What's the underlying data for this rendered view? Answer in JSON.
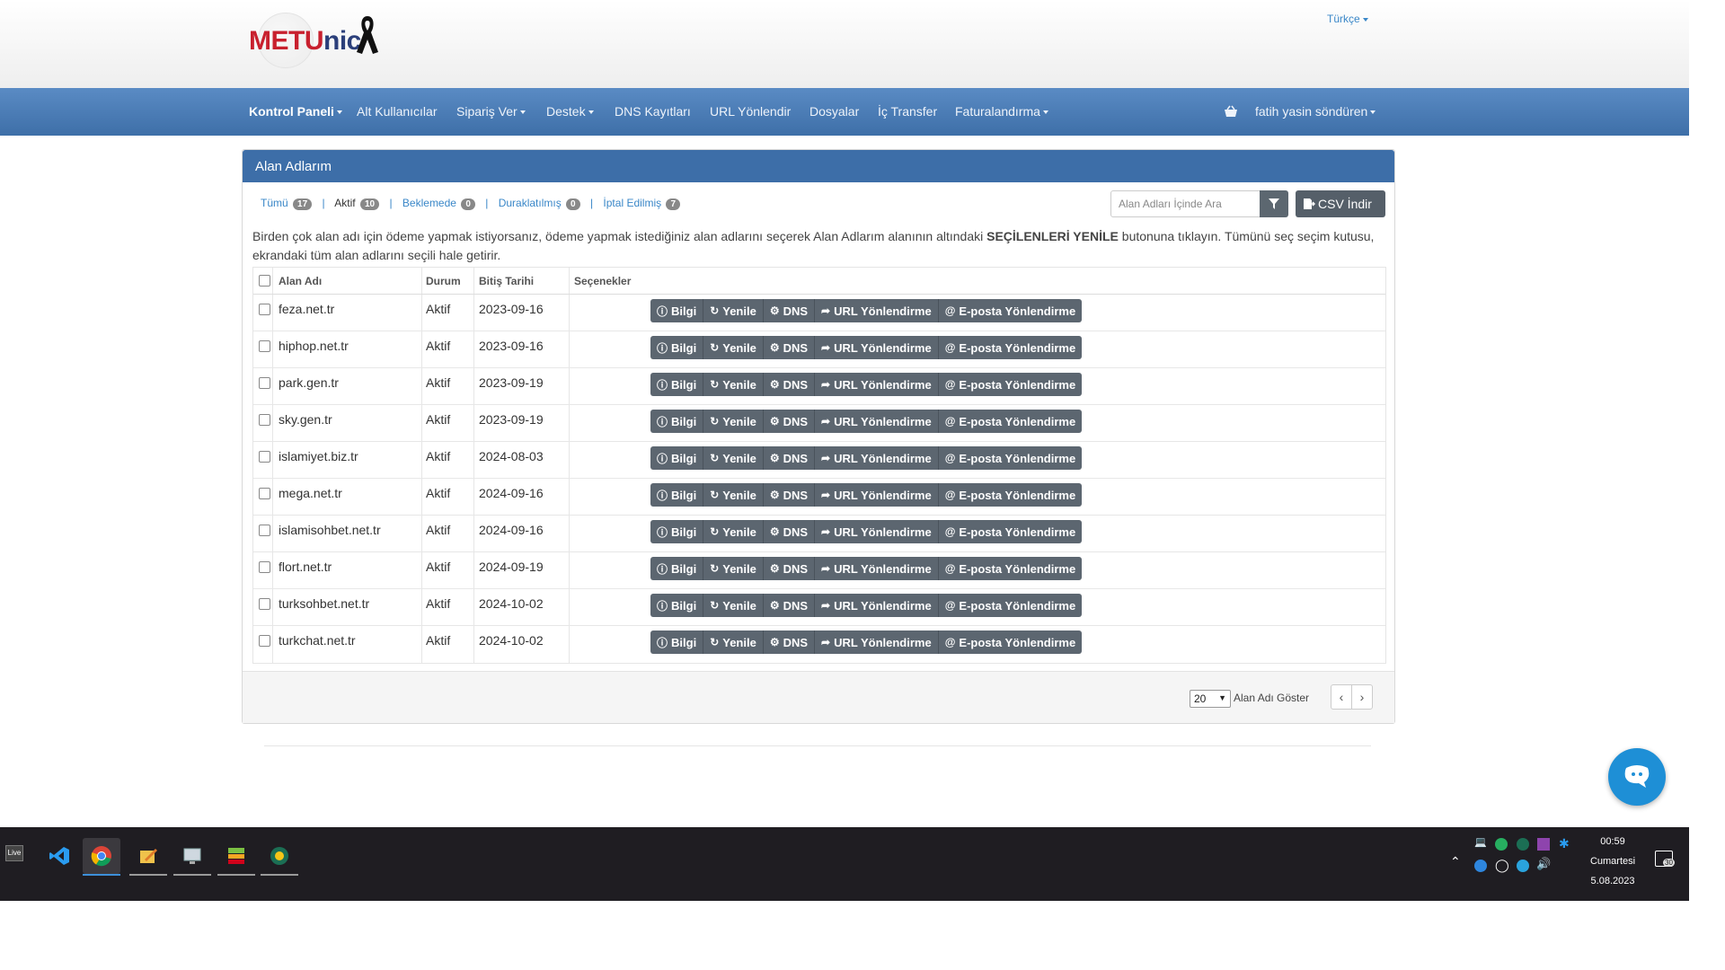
{
  "header": {
    "logo_text_metu": "METU",
    "logo_text_nic": "nic",
    "language": "Türkçe"
  },
  "nav": {
    "items": [
      "Kontrol Paneli",
      "Alt Kullanıcılar",
      "Sipariş Ver",
      "Destek",
      "DNS Kayıtları",
      "URL Yönlendir",
      "Dosyalar",
      "İç Transfer",
      "Faturalandırma"
    ],
    "user": "fatih yasin söndüren"
  },
  "panel": {
    "title": "Alan Adlarım",
    "filters": [
      {
        "label": "Tümü",
        "count": "17"
      },
      {
        "label": "Aktif",
        "count": "10"
      },
      {
        "label": "Beklemede",
        "count": "0"
      },
      {
        "label": "Duraklatılmış",
        "count": "0"
      },
      {
        "label": "İptal Edilmiş",
        "count": "7"
      }
    ],
    "search_placeholder": "Alan Adları İçinde Ara",
    "csv_label": "CSV İndir",
    "info_text_1": "Birden çok alan adı için ödeme yapmak istiyorsanız, ödeme yapmak istediğiniz alan adlarını seçerek Alan Adlarım alanının altındaki ",
    "info_bold": "SEÇİLENLERİ YENİLE",
    "info_text_2": " butonuna tıklayın. Tümünü seç seçim kutusu, ekrandaki tüm alan adlarını seçili hale getirir.",
    "columns": [
      "Alan Adı",
      "Durum",
      "Bitiş Tarihi",
      "Seçenekler"
    ],
    "actions": [
      "Bilgi",
      "Yenile",
      "DNS",
      "URL Yönlendirme",
      "E-posta Yönlendirme"
    ],
    "rows": [
      {
        "domain": "feza.net.tr",
        "status": "Aktif",
        "expiry": "2023-09-16"
      },
      {
        "domain": "hiphop.net.tr",
        "status": "Aktif",
        "expiry": "2023-09-16"
      },
      {
        "domain": "park.gen.tr",
        "status": "Aktif",
        "expiry": "2023-09-19"
      },
      {
        "domain": "sky.gen.tr",
        "status": "Aktif",
        "expiry": "2023-09-19"
      },
      {
        "domain": "islamiyet.biz.tr",
        "status": "Aktif",
        "expiry": "2024-08-03"
      },
      {
        "domain": "mega.net.tr",
        "status": "Aktif",
        "expiry": "2024-09-16"
      },
      {
        "domain": "islamisohbet.net.tr",
        "status": "Aktif",
        "expiry": "2024-09-16"
      },
      {
        "domain": "flort.net.tr",
        "status": "Aktif",
        "expiry": "2024-09-19"
      },
      {
        "domain": "turksohbet.net.tr",
        "status": "Aktif",
        "expiry": "2024-10-02"
      },
      {
        "domain": "turkchat.net.tr",
        "status": "Aktif",
        "expiry": "2024-10-02"
      }
    ],
    "per_page_value": "20",
    "per_page_label": "Alan Adı Göster"
  },
  "taskbar": {
    "live_label": "Live",
    "time": "00:59",
    "day": "Cumartesi",
    "date": "5.08.2023",
    "notification_count": "30"
  },
  "colors": {
    "navbar": "#4a7cb8",
    "panel_header": "#3d6ea8",
    "button": "#5c6670",
    "link": "#3a87c8"
  }
}
